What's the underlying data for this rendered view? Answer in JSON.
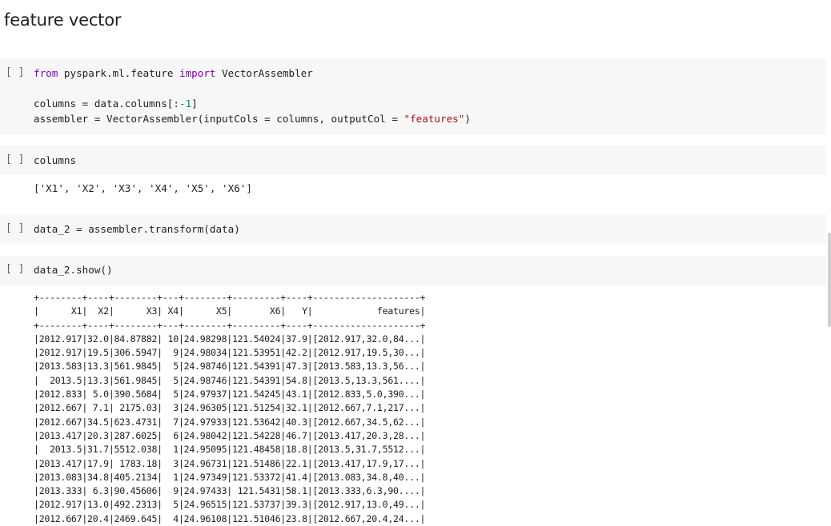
{
  "section": {
    "title": "feature vector"
  },
  "cells": [
    {
      "run_label": "[ ]",
      "code": {
        "l1_kw1": "from",
        "l1_mod": " pyspark.ml.feature ",
        "l1_kw2": "import",
        "l1_name": " VectorAssembler",
        "l3_a": "columns = data.columns[:",
        "l3_num": "-1",
        "l3_b": "]",
        "l4_a": "assembler = VectorAssembler(inputCols = columns, outputCol = ",
        "l4_str": "\"features\"",
        "l4_b": ")"
      }
    },
    {
      "run_label": "[ ]",
      "code": {
        "text": "columns"
      },
      "output": "['X1', 'X2', 'X3', 'X4', 'X5', 'X6']"
    },
    {
      "run_label": "[ ]",
      "code": {
        "text": "data_2 = assembler.transform(data)"
      }
    },
    {
      "run_label": "[ ]",
      "code": {
        "text": "data_2.show()"
      },
      "output_table": [
        "+--------+----+--------+---+--------+---------+----+--------------------+",
        "|      X1|  X2|      X3| X4|      X5|       X6|   Y|            features|",
        "+--------+----+--------+---+--------+---------+----+--------------------+",
        "|2012.917|32.0|84.87882| 10|24.98298|121.54024|37.9|[2012.917,32.0,84...|",
        "|2012.917|19.5|306.5947|  9|24.98034|121.53951|42.2|[2012.917,19.5,30...|",
        "|2013.583|13.3|561.9845|  5|24.98746|121.54391|47.3|[2013.583,13.3,56...|",
        "|  2013.5|13.3|561.9845|  5|24.98746|121.54391|54.8|[2013.5,13.3,561....|",
        "|2012.833| 5.0|390.5684|  5|24.97937|121.54245|43.1|[2012.833,5.0,390...|",
        "|2012.667| 7.1| 2175.03|  3|24.96305|121.51254|32.1|[2012.667,7.1,217...|",
        "|2012.667|34.5|623.4731|  7|24.97933|121.53642|40.3|[2012.667,34.5,62...|",
        "|2013.417|20.3|287.6025|  6|24.98042|121.54228|46.7|[2013.417,20.3,28...|",
        "|  2013.5|31.7|5512.038|  1|24.95095|121.48458|18.8|[2013.5,31.7,5512...|",
        "|2013.417|17.9| 1783.18|  3|24.96731|121.51486|22.1|[2013.417,17.9,17...|",
        "|2013.083|34.8|405.2134|  1|24.97349|121.53372|41.4|[2013.083,34.8,40...|",
        "|2013.333| 6.3|90.45606|  9|24.97433| 121.5431|58.1|[2013.333,6.3,90....|",
        "|2012.917|13.0|492.2313|  5|24.96515|121.53737|39.3|[2012.917,13.0,49...|",
        "|2012.667|20.4|2469.645|  4|24.96108|121.51046|23.8|[2012.667,20.4,24...|"
      ]
    }
  ]
}
